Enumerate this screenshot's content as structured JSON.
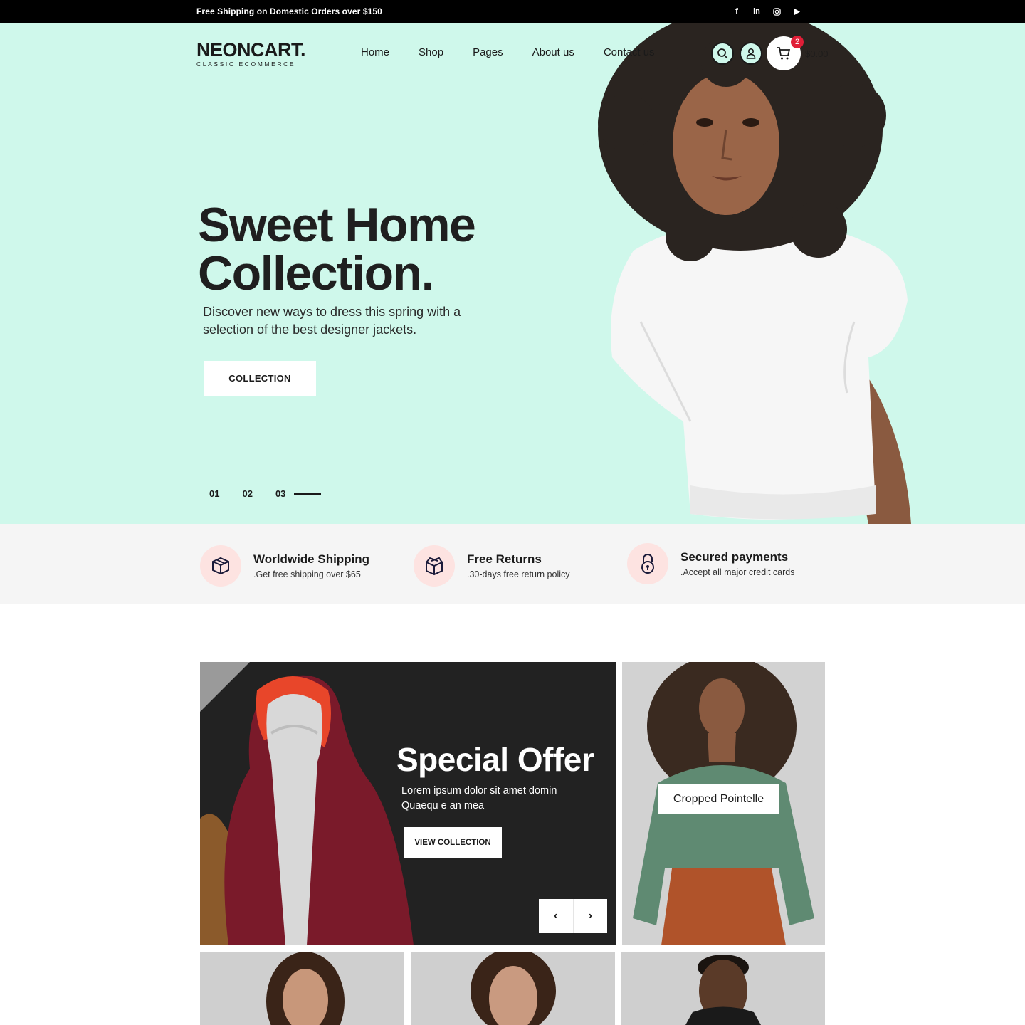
{
  "topbar": {
    "promo": "Free Shipping on Domestic Orders over $150",
    "socials": [
      "facebook-icon",
      "linkedin-icon",
      "instagram-icon",
      "play-icon"
    ]
  },
  "header": {
    "brand": "NEONCART.",
    "tagline": "CLASSIC ECOMMERCE",
    "nav": [
      "Home",
      "Shop",
      "Pages",
      "About us",
      "Contact us"
    ],
    "cart_count": "2",
    "cart_total": "$0.00"
  },
  "hero": {
    "title_line1": "Sweet Home",
    "title_line2": "Collection.",
    "subtitle": "Discover new ways to dress this spring with a selection of the best designer jackets.",
    "button": "COLLECTION",
    "slides": [
      "01",
      "02",
      "03"
    ],
    "bg_color": "#cff8eb"
  },
  "features": [
    {
      "title": "Worldwide Shipping",
      "desc": ".Get free shipping over $65",
      "icon": "box-icon"
    },
    {
      "title": "Free Returns",
      "desc": ".30-days free return policy",
      "icon": "return-box-icon"
    },
    {
      "title": "Secured payments",
      "desc": ".Accept all major credit cards",
      "icon": "lock-icon"
    }
  ],
  "promo": {
    "title": "Special Offer",
    "desc": "Lorem ipsum dolor sit amet domin Quaequ e an mea",
    "button": "VIEW COLLECTION",
    "prev": "‹",
    "next": "›"
  },
  "side_card": {
    "label": "Cropped Pointelle"
  },
  "accent": {
    "badge": "#e01e37",
    "feature_circle": "#fde3e1"
  }
}
